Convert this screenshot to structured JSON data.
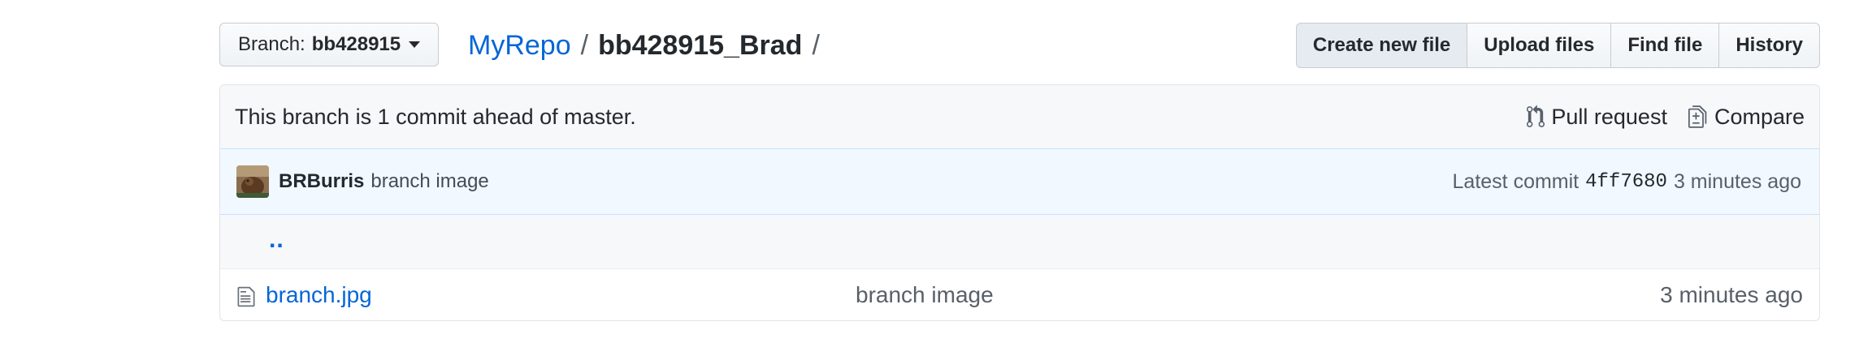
{
  "branch_select": {
    "prefix": "Branch:",
    "name": "bb428915"
  },
  "breadcrumb": {
    "repo": "MyRepo",
    "separator": "/",
    "directory": "bb428915_Brad",
    "trailing_separator": "/"
  },
  "toolbar": {
    "create_new_file": "Create new file",
    "upload_files": "Upload files",
    "find_file": "Find file",
    "history": "History"
  },
  "ahead_bar": {
    "message": "This branch is 1 commit ahead of master.",
    "pull_request": "Pull request",
    "compare": "Compare"
  },
  "commit": {
    "author": "BRBurris",
    "message": "branch image",
    "latest_label": "Latest commit",
    "sha": "4ff7680",
    "age": "3 minutes ago"
  },
  "files": {
    "up_label": "..",
    "rows": [
      {
        "name": "branch.jpg",
        "commit_message": "branch image",
        "age": "3 minutes ago"
      }
    ]
  },
  "colors": {
    "link": "#0366d6",
    "commit_bar_bg": "#f1f8ff",
    "header_bg": "#f6f8fa",
    "border": "#e1e4e8"
  }
}
